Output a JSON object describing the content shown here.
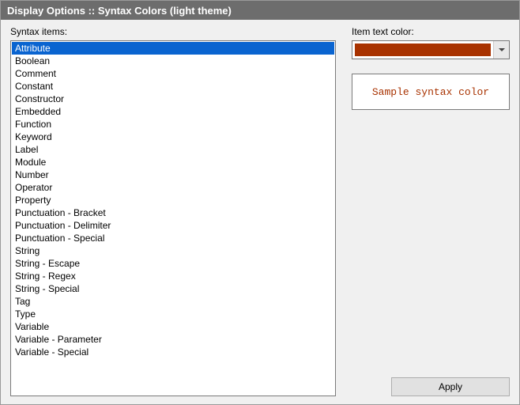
{
  "title": "Display Options :: Syntax Colors (light theme)",
  "left": {
    "label": "Syntax items:",
    "selected_index": 0,
    "items": [
      "Attribute",
      "Boolean",
      "Comment",
      "Constant",
      "Constructor",
      "Embedded",
      "Function",
      "Keyword",
      "Label",
      "Module",
      "Number",
      "Operator",
      "Property",
      "Punctuation - Bracket",
      "Punctuation - Delimiter",
      "Punctuation - Special",
      "String",
      "String - Escape",
      "String - Regex",
      "String - Special",
      "Tag",
      "Type",
      "Variable",
      "Variable - Parameter",
      "Variable - Special"
    ]
  },
  "right": {
    "label": "Item text color:",
    "color": "#a83200",
    "sample_text": "Sample syntax color"
  },
  "buttons": {
    "apply": "Apply"
  }
}
